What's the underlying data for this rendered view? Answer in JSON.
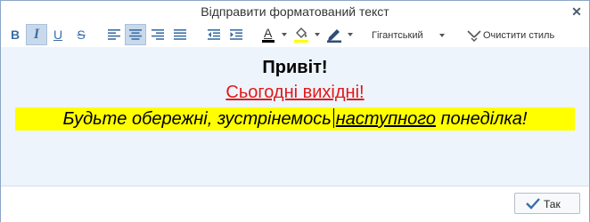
{
  "window": {
    "title": "Відправити форматований текст",
    "close_glyph": "✕"
  },
  "toolbar": {
    "bold_label": "B",
    "italic_label": "I",
    "underline_label": "U",
    "strike_label": "S",
    "font_color_label": "A",
    "font_color": "#000000",
    "highlight_color": "#ffff00",
    "font_size": "Гігантський",
    "clear_style_label": "Очистити стиль",
    "active_buttons": [
      "italic",
      "align-center"
    ]
  },
  "editor": {
    "line1": "Привіт!",
    "line2": "Сьогодні вихідні!",
    "line3_part1": "Будьте обережні, зустрінемось",
    "line3_part2": "наступного",
    "line3_part3": "понеділка!",
    "line2_color": "#e01a1a",
    "highlight": "#ffff00"
  },
  "footer": {
    "ok_label": "Так"
  },
  "colors": {
    "accent": "#3a6ea5",
    "background": "#eef4fb",
    "border": "#8aa6c8"
  }
}
